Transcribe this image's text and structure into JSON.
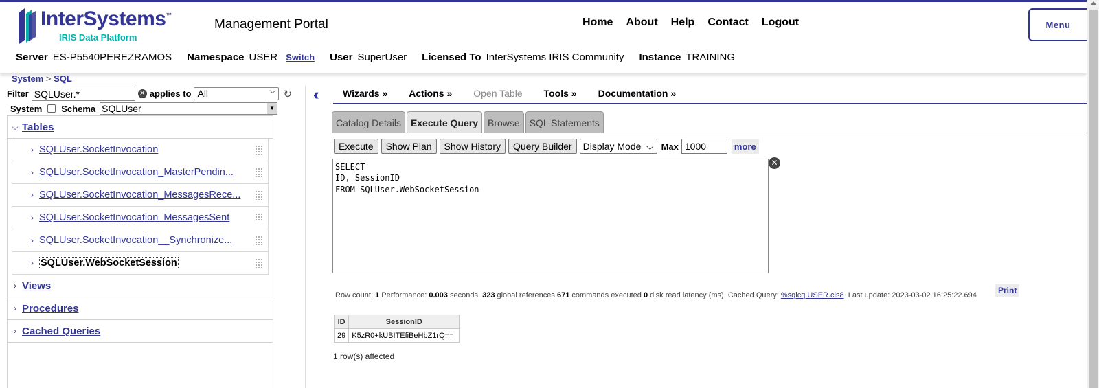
{
  "header": {
    "logo_name": "InterSystems",
    "logo_tm": "™",
    "logo_sub": "IRIS Data Platform",
    "title": "Management Portal",
    "nav": [
      "Home",
      "About",
      "Help",
      "Contact",
      "Logout"
    ],
    "menu_label": "Menu",
    "brand_color": "#333695",
    "accent_color": "#00b2a9"
  },
  "info": {
    "server_label": "Server",
    "server": "ES-P5540PEREZRAMOS",
    "namespace_label": "Namespace",
    "namespace": "USER",
    "switch_label": "Switch",
    "user_label": "User",
    "user": "SuperUser",
    "licensed_label": "Licensed To",
    "licensed": "InterSystems IRIS Community",
    "instance_label": "Instance",
    "instance": "TRAINING"
  },
  "breadcrumb": {
    "system": "System",
    "sep": ">",
    "sql": "SQL"
  },
  "filter": {
    "label": "Filter",
    "value": "SQLUser.*",
    "applies_label": "applies to",
    "applies_value": "All",
    "system_label": "System",
    "schema_label": "Schema",
    "schema_value": "SQLUser"
  },
  "tree": {
    "tables_label": "Tables",
    "tables": [
      "SQLUser.SocketInvocation",
      "SQLUser.SocketInvocation_MasterPendin...",
      "SQLUser.SocketInvocation_MessagesRece...",
      "SQLUser.SocketInvocation_MessagesSent",
      "SQLUser.SocketInvocation__Synchronize...",
      "SQLUser.WebSocketSession"
    ],
    "views_label": "Views",
    "procedures_label": "Procedures",
    "cached_label": "Cached Queries"
  },
  "actions": {
    "wizards": "Wizards »",
    "actions": "Actions »",
    "open_table": "Open Table",
    "tools": "Tools »",
    "documentation": "Documentation »"
  },
  "tabs": [
    "Catalog Details",
    "Execute Query",
    "Browse",
    "SQL Statements"
  ],
  "query": {
    "execute": "Execute",
    "show_plan": "Show Plan",
    "show_history": "Show History",
    "query_builder": "Query Builder",
    "display_mode": "Display Mode",
    "max_label": "Max",
    "max_value": "1000",
    "more": "more",
    "text": "SELECT\nID, SessionID\nFROM SQLUser.WebSocketSession"
  },
  "stats": {
    "row_count_label": "Row count:",
    "row_count": "1",
    "performance_label": "Performance:",
    "performance": "0.003",
    "seconds": "seconds",
    "global_refs": "323",
    "global_refs_label": "global references",
    "commands": "671",
    "commands_label": "commands executed",
    "disk": "0",
    "disk_label": "disk read latency (ms)",
    "cached_label": "Cached Query:",
    "cached": "%sqlcq.USER.cls8",
    "last_update_label": "Last update:",
    "last_update": "2023-03-02 16:25:22.694",
    "print": "Print"
  },
  "results": {
    "columns": [
      "ID",
      "SessionID"
    ],
    "rows": [
      [
        "29",
        "K5zR0+kUBITEfiBeHbZ1rQ=="
      ]
    ],
    "affected": "1 row(s) affected"
  }
}
